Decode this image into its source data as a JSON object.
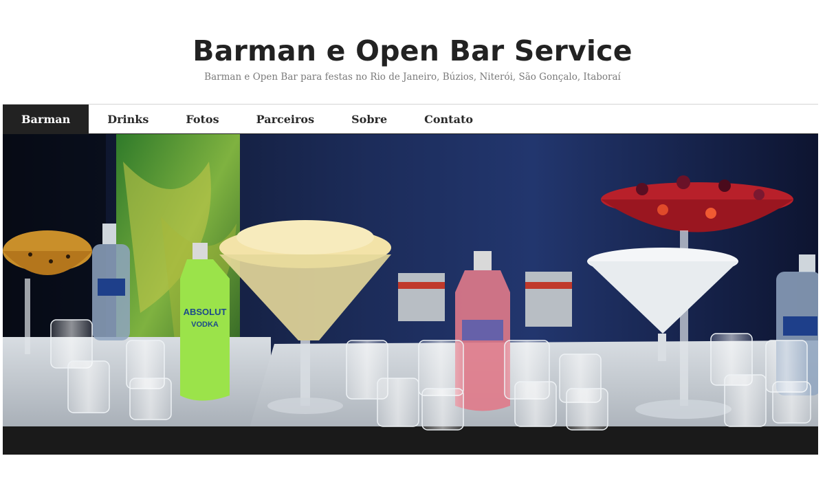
{
  "header": {
    "title": "Barman e Open Bar Service",
    "tagline": "Barman e Open Bar para festas no Rio de Janeiro, Búzios, Niterói, São Gonçalo, Itaboraí"
  },
  "nav": {
    "items": [
      {
        "label": "Barman",
        "active": true
      },
      {
        "label": "Drinks",
        "active": false
      },
      {
        "label": "Fotos",
        "active": false
      },
      {
        "label": "Parceiros",
        "active": false
      },
      {
        "label": "Sobre",
        "active": false
      },
      {
        "label": "Contato",
        "active": false
      }
    ]
  },
  "hero": {
    "bottle_label_1": "ABSOLUT",
    "bottle_label_2": "VODKA"
  },
  "colors": {
    "nav_active_bg": "#222222",
    "title": "#222222",
    "tagline": "#7a7a7a"
  }
}
